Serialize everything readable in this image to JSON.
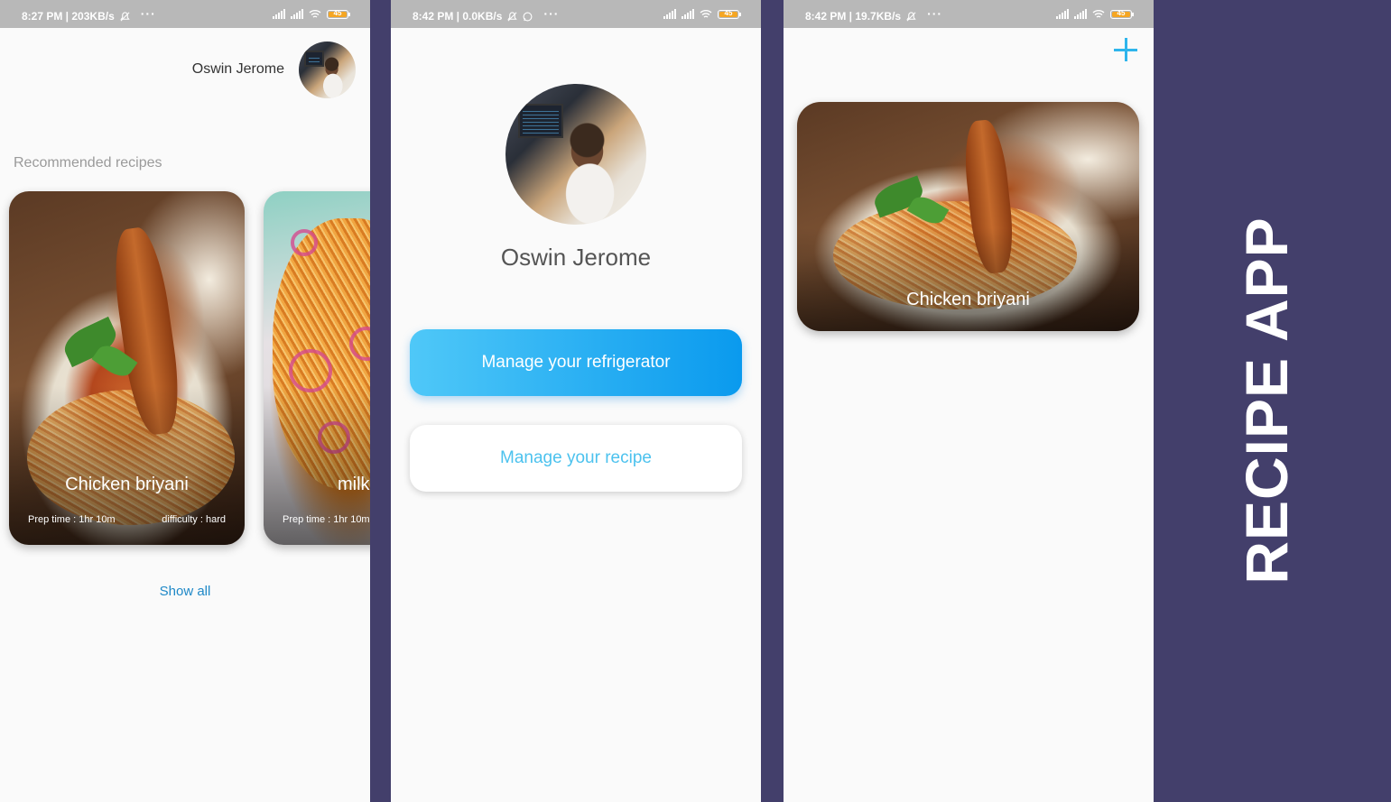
{
  "screens": [
    {
      "status": {
        "time_info": "8:27 PM | 203KB/s",
        "battery": "45"
      }
    },
    {
      "status": {
        "time_info": "8:42 PM | 0.0KB/s",
        "battery": "45"
      }
    },
    {
      "status": {
        "time_info": "8:42 PM | 19.7KB/s",
        "battery": "45"
      }
    }
  ],
  "home": {
    "user_name": "Oswin Jerome",
    "section_title": "Recommended recipes",
    "recipes": [
      {
        "name": "Chicken briyani",
        "prep_time": "Prep time : 1hr 10m",
        "difficulty": "difficulty : hard"
      },
      {
        "name": "milk",
        "prep_time": "Prep time : 1hr 10m"
      }
    ],
    "show_all_label": "Show all"
  },
  "profile": {
    "user_name": "Oswin Jerome",
    "manage_fridge_label": "Manage your refrigerator",
    "manage_recipe_label": "Manage your recipe"
  },
  "my_recipes": {
    "add_icon": "plus-icon",
    "recipes": [
      {
        "name": "Chicken briyani"
      }
    ]
  },
  "banner": {
    "title": "RECIPE APP"
  },
  "colors": {
    "background": "#433f6b",
    "accent": "#2eb5ec",
    "link": "#1e88c7",
    "gradient_start": "#4fc8f8",
    "gradient_end": "#0a9aee"
  }
}
